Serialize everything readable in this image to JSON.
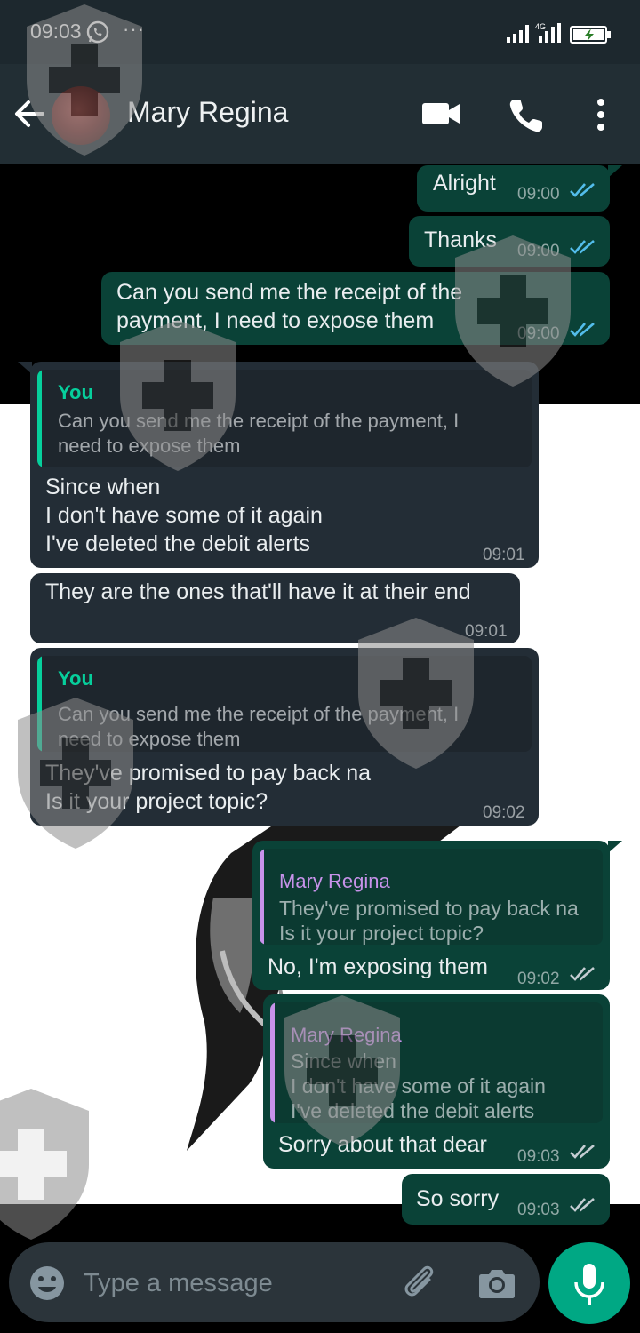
{
  "status_bar": {
    "time": "09:03",
    "more": "···",
    "network": "4G"
  },
  "header": {
    "contact_name": "Mary Regina"
  },
  "messages": [
    {
      "type": "out",
      "text": "Alright",
      "time": "09:00"
    },
    {
      "type": "out",
      "text": "Thanks",
      "time": "09:00"
    },
    {
      "type": "out",
      "text": "Can you send me the receipt of the\npayment, I need to expose them",
      "time": "09:00"
    },
    {
      "type": "in",
      "quote_author": "You",
      "quote_text": "Can you send me the receipt of the payment, I\nneed to expose them",
      "text": "Since when\nI don't have some of it again\nI've deleted the debit alerts",
      "time": "09:01"
    },
    {
      "type": "in",
      "text": "They are the ones that'll have it at their end",
      "time": "09:01"
    },
    {
      "type": "in",
      "quote_author": "You",
      "quote_text": "Can you send me the receipt of the payment, I\nneed to expose them",
      "text": "They've promised to pay back na\nIs it your project topic?",
      "time": "09:02"
    },
    {
      "type": "out",
      "quote_author": "Mary Regina",
      "quote_text": "They've promised to pay back na\nIs it your project topic?",
      "text": "No, I'm exposing them",
      "time": "09:02"
    },
    {
      "type": "out",
      "quote_author": "Mary Regina",
      "quote_text": "Since when\nI don't have some of it again\nI've deleted the debit alerts",
      "text": "Sorry about that dear",
      "time": "09:03"
    },
    {
      "type": "out",
      "text": "So sorry",
      "time": "09:03"
    }
  ],
  "input": {
    "placeholder": "Type a message"
  },
  "colors": {
    "outgoing_bubble": "#0a4237",
    "incoming_bubble": "#232d36",
    "header": "#222e34",
    "accent": "#00a884",
    "read_ticks": "#53bdeb",
    "delivered_ticks": "#c4cdd2",
    "quote_you": "#06cf9c",
    "quote_contact": "#c792ea"
  },
  "icons": {
    "back": "arrow-left-icon",
    "video": "video-camera-icon",
    "call": "phone-icon",
    "menu": "more-vertical-icon",
    "emoji": "emoji-icon",
    "attach": "paperclip-icon",
    "camera": "camera-icon",
    "mic": "microphone-icon",
    "watermark": "shield-cross-watermark"
  }
}
